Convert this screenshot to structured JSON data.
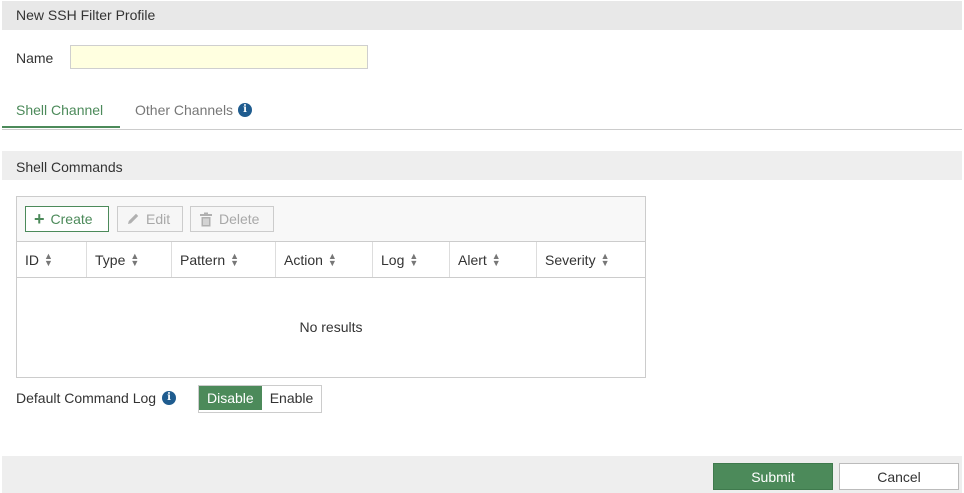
{
  "header": {
    "title": "New SSH Filter Profile"
  },
  "form": {
    "name_label": "Name",
    "name_value": "",
    "name_placeholder": ""
  },
  "tabs": [
    {
      "label": "Shell Channel",
      "active": true
    },
    {
      "label": "Other Channels",
      "active": false,
      "icon": "info-icon"
    }
  ],
  "section": {
    "title": "Shell Commands"
  },
  "toolbar": {
    "create_label": "Create",
    "edit_label": "Edit",
    "delete_label": "Delete"
  },
  "table": {
    "columns": [
      "ID",
      "Type",
      "Pattern",
      "Action",
      "Log",
      "Alert",
      "Severity"
    ],
    "rows": [],
    "empty_text": "No results"
  },
  "default_command_log": {
    "label": "Default Command Log",
    "options": [
      "Disable",
      "Enable"
    ],
    "selected": "Disable"
  },
  "footer": {
    "submit_label": "Submit",
    "cancel_label": "Cancel"
  },
  "colors": {
    "accent": "#4c8a5a",
    "info": "#1f5c8f",
    "name_input_bg": "#ffffe0"
  }
}
